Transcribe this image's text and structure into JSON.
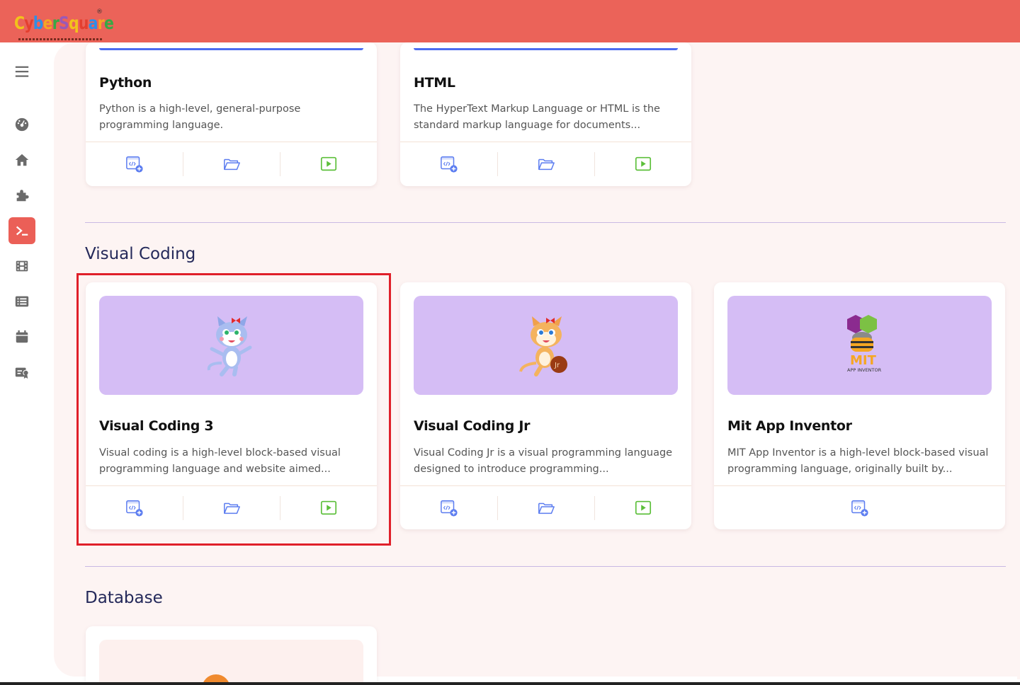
{
  "brand": {
    "logo_text": "CyberSquare",
    "registered": "®"
  },
  "sidebar": {
    "items": [
      {
        "name": "menu-icon"
      },
      {
        "name": "dashboard-icon"
      },
      {
        "name": "home-icon"
      },
      {
        "name": "puzzle-icon"
      },
      {
        "name": "terminal-icon",
        "active": true
      },
      {
        "name": "film-icon"
      },
      {
        "name": "list-icon"
      },
      {
        "name": "calendar-icon"
      },
      {
        "name": "certificate-icon"
      }
    ]
  },
  "sections": {
    "top_cards": [
      {
        "title": "Python",
        "desc": "Python is a high-level, general-purpose programming language."
      },
      {
        "title": "HTML",
        "desc": "The HyperText Markup Language or HTML is the standard markup language for documents..."
      }
    ],
    "visual_coding": {
      "heading": "Visual Coding",
      "cards": [
        {
          "title": "Visual Coding 3",
          "desc": "Visual coding is a high-level block-based visual programming language and website aimed..."
        },
        {
          "title": "Visual Coding Jr",
          "desc": "Visual Coding Jr is a visual programming language designed to introduce programming..."
        },
        {
          "title": "Mit App Inventor",
          "desc": "MIT App Inventor is a high-level block-based visual programming language, originally built by...",
          "logo_text": "MIT",
          "logo_sub": "APP INVENTOR"
        }
      ]
    },
    "database": {
      "heading": "Database"
    }
  },
  "colors": {
    "topbar": "#eb6359",
    "accent": "#eb5f57",
    "thumb": "#d5bdf5",
    "icon_blue": "#5b7cf0",
    "icon_green": "#5cbf3a"
  }
}
